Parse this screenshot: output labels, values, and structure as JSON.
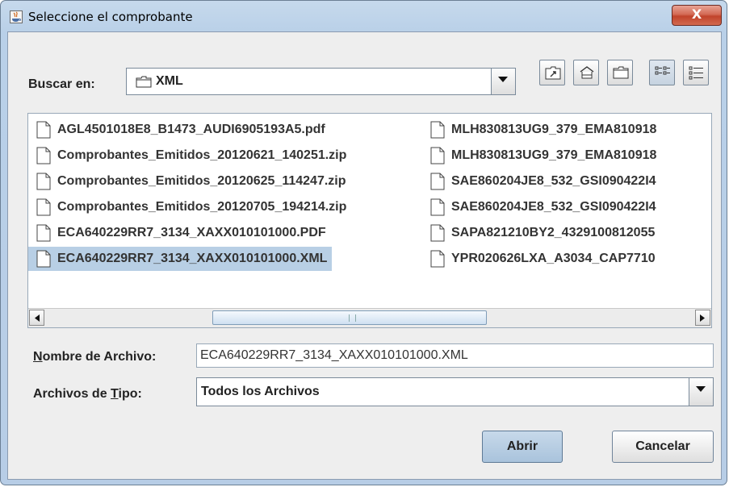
{
  "window": {
    "title": "Seleccione el comprobante",
    "close_label": "X"
  },
  "lookin": {
    "label": "Buscar en:",
    "value": "XML"
  },
  "toolbar": {
    "buttons": [
      "up-one-level-icon",
      "home-icon",
      "new-folder-icon",
      "list-view-icon",
      "details-view-icon"
    ]
  },
  "files": {
    "column1": [
      "AGL4501018E8_B1473_AUDI6905193A5.pdf",
      "Comprobantes_Emitidos_20120621_140251.zip",
      "Comprobantes_Emitidos_20120625_114247.zip",
      "Comprobantes_Emitidos_20120705_194214.zip",
      "ECA640229RR7_3134_XAXX010101000.PDF",
      "ECA640229RR7_3134_XAXX010101000.XML"
    ],
    "column2": [
      "MLH830813UG9_379_EMA810918",
      "MLH830813UG9_379_EMA810918",
      "SAE860204JE8_532_GSI090422I4",
      "SAE860204JE8_532_GSI090422I4",
      "SAPA821210BY2_43291008120​55",
      "YPR020626LXA_A3034_CAP7710"
    ],
    "selected": "ECA640229RR7_3134_XAXX010101000.XML"
  },
  "filename": {
    "label_mnemonic": "N",
    "label_rest": "ombre de Archivo:",
    "value": "ECA640229RR7_3134_XAXX010101000.XML"
  },
  "filetype": {
    "label_pre": "Archivos de ",
    "label_mnemonic": "T",
    "label_post": "ipo:",
    "value": "Todos los Archivos"
  },
  "buttons": {
    "open": "Abrir",
    "cancel": "Cancelar"
  },
  "colors": {
    "selection": "#b8cfe5",
    "close_button": "#c1432b"
  }
}
